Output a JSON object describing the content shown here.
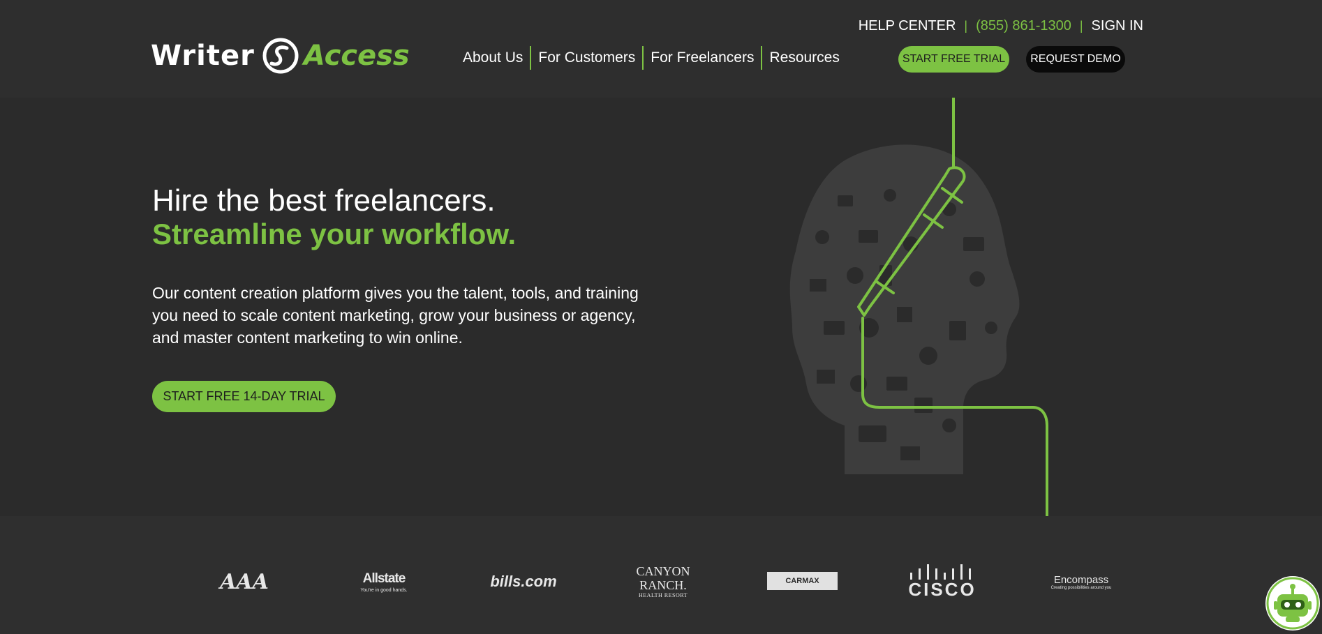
{
  "header": {
    "logo": {
      "word1": "Writer",
      "word2": "Access"
    },
    "top_links": {
      "help": "HELP CENTER",
      "phone": "(855) 861-1300",
      "sign_in": "SIGN IN",
      "separator": "|"
    },
    "nav": [
      "About Us",
      "For Customers",
      "For Freelancers",
      "Resources"
    ],
    "cta_trial": "START FREE TRIAL",
    "cta_demo": "REQUEST DEMO"
  },
  "hero": {
    "title_line1": "Hire the best freelancers.",
    "title_line2": "Streamline your workflow.",
    "description": "Our content creation platform gives you the talent, tools, and training you need to scale content marketing, grow your business or agency, and master content marketing to win online.",
    "cta": "START FREE 14-DAY TRIAL"
  },
  "clients": {
    "aaa": "AAA",
    "allstate": "Allstate",
    "allstate_tag": "You're in good hands.",
    "bills": "bills.com",
    "canyon1": "CANYON",
    "canyon2": "RANCH.",
    "canyon_sub": "HEALTH RESORT",
    "carmax": "CARMAX",
    "cisco": "CISCO",
    "encompass": "Encompass",
    "encompass_sub": "Creating possibilities around you"
  },
  "colors": {
    "accent": "#7dc243",
    "background": "#2b2b2b",
    "header": "#2e2e2e"
  },
  "icons": {
    "chat": "chatbot-icon",
    "hero": "pen-head-illustration"
  }
}
